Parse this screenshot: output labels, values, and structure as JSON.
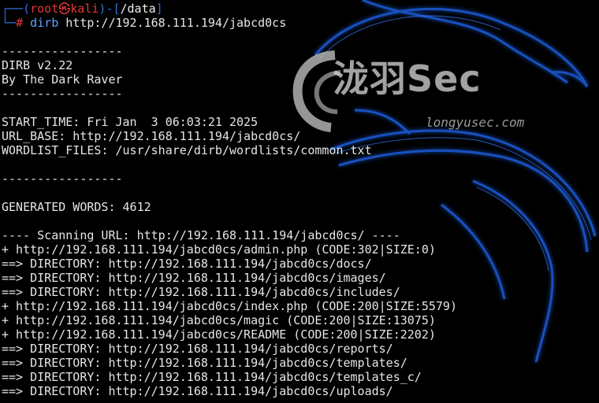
{
  "prompt": {
    "bracket_open": "┌──(",
    "user": "root",
    "skull": "㉿",
    "host": "kali",
    "bracket_mid": ")-[",
    "path": "/data",
    "bracket_close": "]",
    "line2_prefix": "└─",
    "hash": "#",
    "command": "dirb",
    "argument": "http://192.168.111.194/jabcd0cs"
  },
  "watermark": {
    "title": "泷羽Sec",
    "url": "longyusec.com"
  },
  "output": [
    "",
    "-----------------",
    "DIRB v2.22",
    "By The Dark Raver",
    "-----------------",
    "",
    "START_TIME: Fri Jan  3 06:03:21 2025",
    "URL_BASE: http://192.168.111.194/jabcd0cs/",
    "WORDLIST_FILES: /usr/share/dirb/wordlists/common.txt",
    "",
    "-----------------",
    "",
    "GENERATED WORDS: 4612",
    "",
    "---- Scanning URL: http://192.168.111.194/jabcd0cs/ ----",
    "+ http://192.168.111.194/jabcd0cs/admin.php (CODE:302|SIZE:0)",
    "==> DIRECTORY: http://192.168.111.194/jabcd0cs/docs/",
    "==> DIRECTORY: http://192.168.111.194/jabcd0cs/images/",
    "==> DIRECTORY: http://192.168.111.194/jabcd0cs/includes/",
    "+ http://192.168.111.194/jabcd0cs/index.php (CODE:200|SIZE:5579)",
    "+ http://192.168.111.194/jabcd0cs/magic (CODE:200|SIZE:13075)",
    "+ http://192.168.111.194/jabcd0cs/README (CODE:200|SIZE:2202)",
    "==> DIRECTORY: http://192.168.111.194/jabcd0cs/reports/",
    "==> DIRECTORY: http://192.168.111.194/jabcd0cs/templates/",
    "==> DIRECTORY: http://192.168.111.194/jabcd0cs/templates_c/",
    "==> DIRECTORY: http://192.168.111.194/jabcd0cs/uploads/"
  ],
  "colors": {
    "background": "#000000",
    "prompt_blue": "#2e6fd8",
    "prompt_red": "#e53935",
    "command_blue": "#5aa6ff",
    "text": "#e6e6e6",
    "dragon_glow": "#1e5fe0"
  },
  "icons": [
    "kali-dragon-wallpaper-icon",
    "longyusec-logo-icon"
  ]
}
